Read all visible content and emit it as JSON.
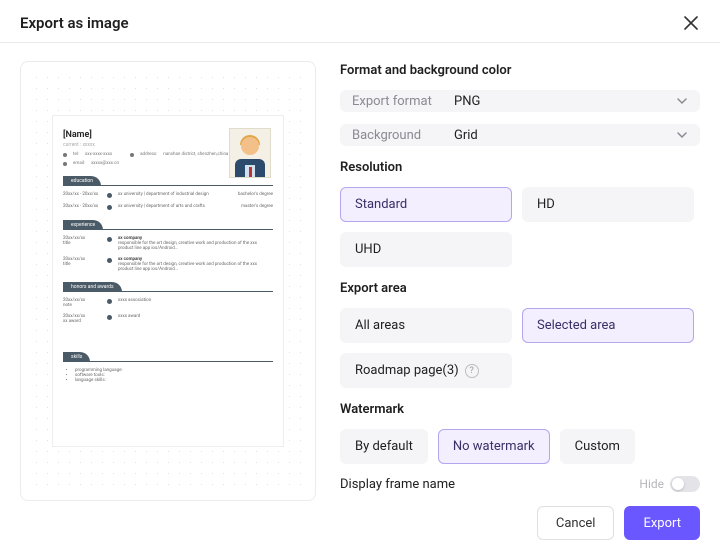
{
  "header": {
    "title": "Export as image"
  },
  "sections": {
    "format": {
      "title": "Format and background color",
      "export_format_label": "Export format",
      "export_format_value": "PNG",
      "background_label": "Background",
      "background_value": "Grid"
    },
    "resolution": {
      "title": "Resolution",
      "options": {
        "standard": "Standard",
        "hd": "HD",
        "uhd": "UHD"
      },
      "selected": "standard"
    },
    "export_area": {
      "title": "Export area",
      "options": {
        "all": "All areas",
        "selected": "Selected area",
        "roadmap": "Roadmap page(3)"
      },
      "selected": "selected"
    },
    "watermark": {
      "title": "Watermark",
      "options": {
        "default": "By default",
        "none": "No watermark",
        "custom": "Custom"
      },
      "selected": "none"
    },
    "display_frame": {
      "label": "Display frame name",
      "hide_label": "Hide",
      "value": false
    }
  },
  "footer": {
    "cancel": "Cancel",
    "export": "Export"
  },
  "preview": {
    "name": "[Name]",
    "subtitle": "current : xxxxx",
    "phone_label": "tel:",
    "phone": "xxx-xxxx-xxxx",
    "address_label": "address:",
    "address": "nanshan district, shenzhen,china",
    "email_label": "email:",
    "email": "xxxxx@xxx.cn",
    "sections": {
      "education": "education",
      "experience": "experience",
      "honors": "honors and awards",
      "skills": "skills"
    },
    "edu": [
      {
        "date": "20xx/xx - 20xx/xx",
        "text": "xx university | department of industrial design",
        "right": "bachelor's degree"
      },
      {
        "date": "20xx/xx - 20xx/xx",
        "text": "xx university | department of arts and crafts",
        "right": "master's degree"
      }
    ],
    "exp": [
      {
        "date": "20xx/xx/xx",
        "sub": "title",
        "title": "xx company",
        "desc": "responsible for the art design, creative work and production of the xxx product line app ios/Android..."
      },
      {
        "date": "20xx/xx/xx",
        "sub": "title",
        "title": "xx company",
        "desc": "responsible for the art design, creative work and production of the xxx product line app ios/Android..."
      }
    ],
    "honors": [
      {
        "date": "20xx/xx/xx",
        "sub": "note",
        "title": "xxxx association"
      },
      {
        "date": "20xx/xx/xx",
        "sub": "xx award",
        "title": "xxxx award"
      }
    ],
    "skills": [
      "programming language:",
      "software tools:",
      "language skills:"
    ]
  }
}
